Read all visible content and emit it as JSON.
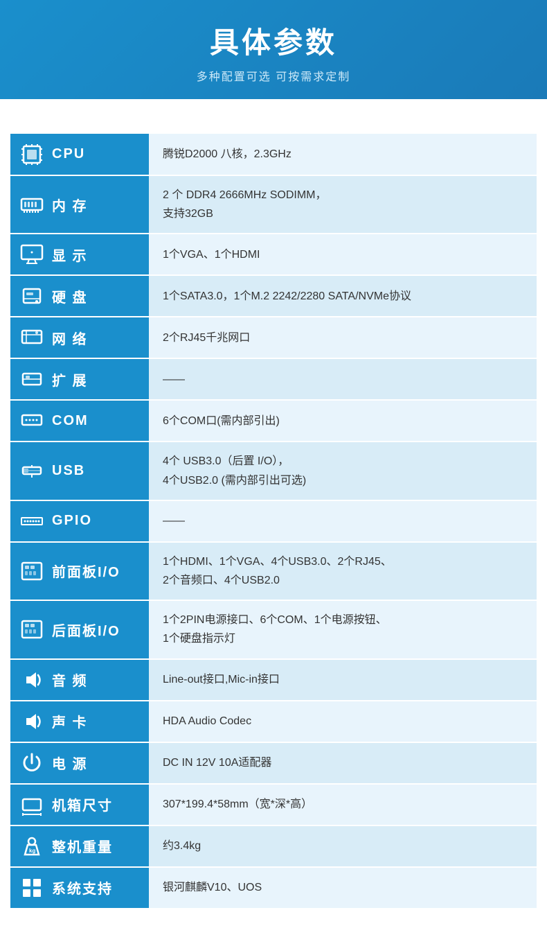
{
  "header": {
    "title": "具体参数",
    "subtitle": "多种配置可选 可按需求定制"
  },
  "rows": [
    {
      "id": "cpu",
      "icon": "cpu",
      "label": "CPU",
      "value": "腾锐D2000 八核，2.3GHz",
      "multiline": false
    },
    {
      "id": "memory",
      "icon": "memory",
      "label": "内 存",
      "value": "2 个 DDR4 2666MHz SODIMM，\n支持32GB",
      "multiline": true
    },
    {
      "id": "display",
      "icon": "display",
      "label": "显 示",
      "value": "1个VGA、1个HDMI",
      "multiline": false
    },
    {
      "id": "disk",
      "icon": "disk",
      "label": "硬 盘",
      "value": "1个SATA3.0，1个M.2 2242/2280 SATA/NVMe协议",
      "multiline": false
    },
    {
      "id": "network",
      "icon": "network",
      "label": "网 络",
      "value": "2个RJ45千兆网口",
      "multiline": false
    },
    {
      "id": "expand",
      "icon": "expand",
      "label": "扩 展",
      "value": "——",
      "multiline": false
    },
    {
      "id": "com",
      "icon": "com",
      "label": "COM",
      "value": "6个COM口(需内部引出)",
      "multiline": false
    },
    {
      "id": "usb",
      "icon": "usb",
      "label": "USB",
      "value": "4个 USB3.0（后置 I/O），\n4个USB2.0 (需内部引出可选)",
      "multiline": true
    },
    {
      "id": "gpio",
      "icon": "gpio",
      "label": "GPIO",
      "value": "——",
      "multiline": false
    },
    {
      "id": "front-io",
      "icon": "front-io",
      "label": "前面板I/O",
      "value": "1个HDMI、1个VGA、4个USB3.0、2个RJ45、\n2个音频口、4个USB2.0",
      "multiline": true
    },
    {
      "id": "rear-io",
      "icon": "rear-io",
      "label": "后面板I/O",
      "value": "1个2PIN电源接口、6个COM、1个电源按钮、\n1个硬盘指示灯",
      "multiline": true
    },
    {
      "id": "audio",
      "icon": "audio",
      "label": "音 频",
      "value": "Line-out接口,Mic-in接口",
      "multiline": false
    },
    {
      "id": "soundcard",
      "icon": "soundcard",
      "label": "声 卡",
      "value": "HDA Audio Codec",
      "multiline": false
    },
    {
      "id": "power",
      "icon": "power",
      "label": "电 源",
      "value": "DC IN 12V 10A适配器",
      "multiline": false
    },
    {
      "id": "size",
      "icon": "size",
      "label": "机箱尺寸",
      "value": "307*199.4*58mm（宽*深*高）",
      "multiline": false
    },
    {
      "id": "weight",
      "icon": "weight",
      "label": "整机重量",
      "value": "约3.4kg",
      "multiline": false
    },
    {
      "id": "os",
      "icon": "os",
      "label": "系统支持",
      "value": "银河麒麟V10、UOS",
      "multiline": false
    }
  ]
}
